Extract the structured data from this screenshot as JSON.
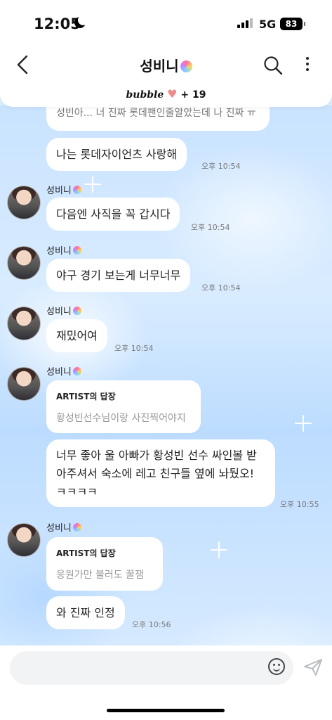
{
  "status_bar": {
    "time": "12:05",
    "network": "5G",
    "battery": "83"
  },
  "header": {
    "title": "성비니",
    "subscription_brand": "bubble",
    "subscription_extra": "+ 19",
    "icons": [
      "back-chevron-icon",
      "search-icon",
      "more-vertical-icon",
      "heart-icon",
      "lollipop-icon"
    ]
  },
  "messages": {
    "m0_text": "성빈아... 너 진짜 롯데팬인줄알았는데 나 진짜 ㅠ",
    "m1_text": "나는 롯데자이언츠 사랑해",
    "m1_time": "오후 10:54",
    "m2_sender": "성비니",
    "m2_text": "다음엔 사직을 꼭 갑시다",
    "m2_time": "오후 10:54",
    "m3_sender": "성비니",
    "m3_text": "야구 경기 보는게 너무너무",
    "m3_time": "오후 10:54",
    "m4_sender": "성비니",
    "m4_text": "재밌어여",
    "m4_time": "오후 10:54",
    "m5_sender": "성비니",
    "m5_reply_title": "ARTIST의 답장",
    "m5_reply_quote": "황성빈선수님이랑 사진찍어야지",
    "m5_text_line1": "너무 좋아 울 아빠가 황성빈 선수 싸인볼 받",
    "m5_text_line2": "아주셔서 숙소에 레고 친구들 옆에 놔뒀오!",
    "m5_text_line3": "ㅋㅋㅋㅋ",
    "m5_time": "오후 10:55",
    "m6_sender": "성비니",
    "m6_reply_title": "ARTIST의 답장",
    "m6_reply_quote": "응원가만 불러도 꿀잼",
    "m6_text": "와 진짜 인정",
    "m6_time": "오후 10:56"
  },
  "input": {
    "placeholder": ""
  },
  "colors": {
    "bubble_bg": "#ffffff",
    "chat_bg": "#cfe6ff",
    "heart": "#f08a8a",
    "time_text": "#777777"
  }
}
